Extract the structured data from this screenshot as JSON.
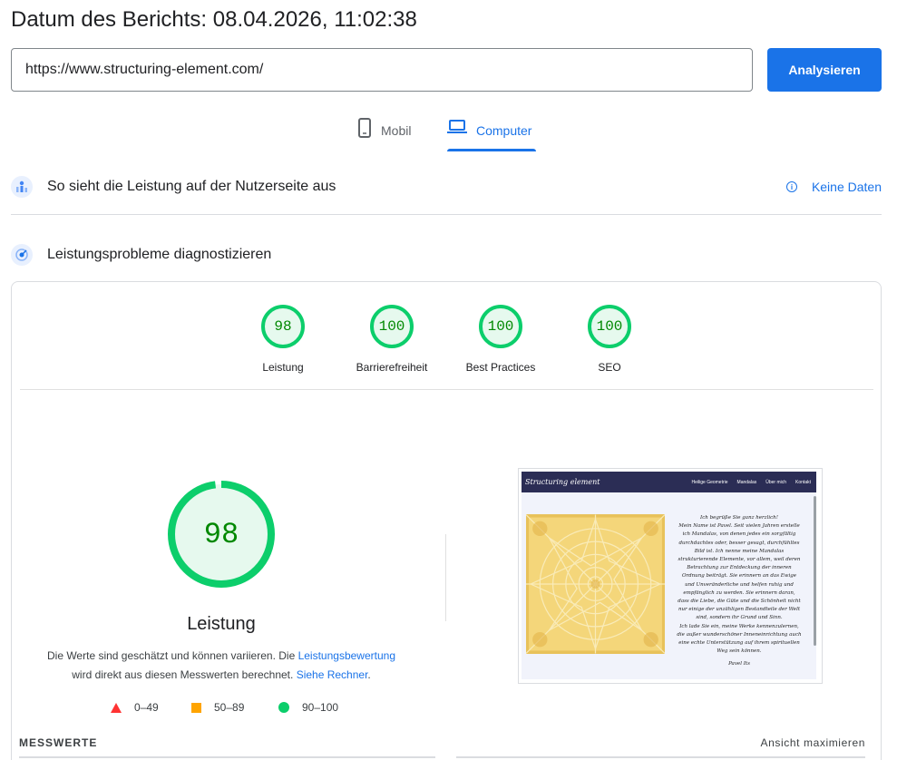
{
  "header": {
    "report_date": "Datum des Berichts: 08.04.2026, 11:02:38"
  },
  "search": {
    "url_value": "https://www.structuring-element.com/",
    "analyze_label": "Analysieren"
  },
  "tabs": [
    {
      "label": "Mobil",
      "icon": "phone-icon",
      "active": false
    },
    {
      "label": "Computer",
      "icon": "laptop-icon",
      "active": true
    }
  ],
  "field_data": {
    "title": "So sieht die Leistung auf der Nutzerseite aus",
    "no_data_label": "Keine Daten"
  },
  "lab_data": {
    "title": "Leistungsprobleme diagnostizieren"
  },
  "scores": [
    {
      "value": "98",
      "label": "Leistung"
    },
    {
      "value": "100",
      "label": "Barrierefreiheit"
    },
    {
      "value": "100",
      "label": "Best Practices"
    },
    {
      "value": "100",
      "label": "SEO"
    }
  ],
  "performance": {
    "score": "98",
    "score_fraction": 0.98,
    "label": "Leistung",
    "desc_part1": "Die Werte sind geschätzt und können variieren. Die ",
    "desc_link1": "Leistungsbewertung",
    "desc_part2": "wird direkt aus diesen Messwerten berechnet. ",
    "desc_link2": "Siehe Rechner",
    "desc_part3": ".",
    "colors": {
      "pass": "#0cce6b",
      "average": "#ffa400",
      "fail": "#ff3333"
    }
  },
  "legend": [
    {
      "range": "0–49",
      "shape": "triangle"
    },
    {
      "range": "50–89",
      "shape": "square"
    },
    {
      "range": "90–100",
      "shape": "circle"
    }
  ],
  "site_preview": {
    "brand": "Structuring element",
    "menu": [
      "Heilige Geometrie",
      "Mandalas",
      "Über mich",
      "Kontakt"
    ],
    "text_lines": [
      "Ich begrüße Sie ganz herzlich!",
      "Mein Name ist Pavel. Seit vielen Jahren erstelle",
      "ich Mandalas, von denen jedes ein sorgfältig",
      "durchdachtes oder, besser gesagt, durchfühltes",
      "Bild ist. Ich nenne meine Mandalas",
      "strukturierende Elemente, vor allem, weil deren",
      "Betrachtung zur Entdeckung der inneren",
      "Ordnung beiträgt. Sie erinnern an das Ewige",
      "und Unveränderliche und helfen ruhig und",
      "empfänglich zu werden. Sie erinnern daran,",
      "dass die Liebe, die Güte und die Schönheit nicht",
      "nur einige der unzähligen Bestandteile der Welt",
      "sind, sondern ihr Grund und Sinn.",
      "Ich lade Sie ein, meine Werke kennenzulernen,",
      "die außer wunderschöner Inneneinrichtung auch",
      "eine echte Unterstützung auf ihrem spirituellen",
      "Weg sein können."
    ],
    "signature": "Pavel Its"
  },
  "metrics": {
    "title": "MESSWERTE",
    "expand_label": "Ansicht maximieren"
  }
}
